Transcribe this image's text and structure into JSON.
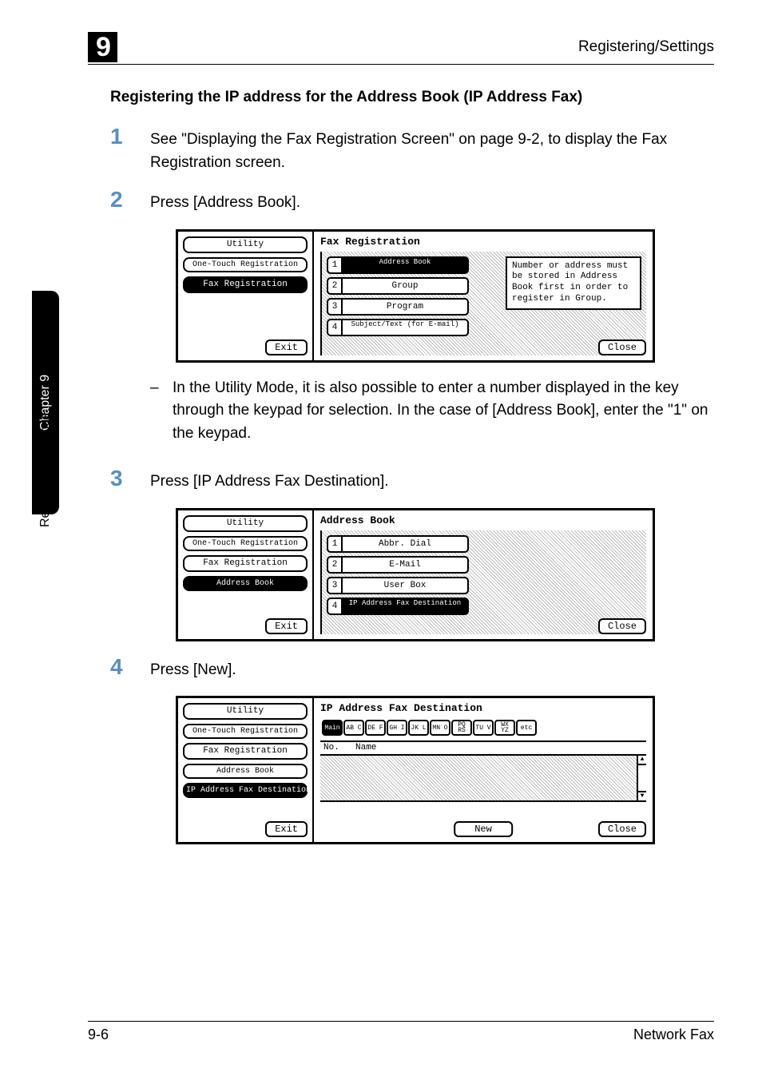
{
  "header": {
    "num": "9",
    "title": "Registering/Settings"
  },
  "side": {
    "chapter": "Chapter 9",
    "section": "Registering/Settings"
  },
  "title": "Registering the IP address for the Address Book (IP Address Fax)",
  "steps": {
    "1": {
      "num": "1",
      "text": "See \"Displaying the Fax Registration Screen\" on page 9-2, to display the Fax Registration screen."
    },
    "2": {
      "num": "2",
      "text": "Press [Address Book]."
    },
    "3": {
      "num": "3",
      "text": "Press [IP Address Fax Destination]."
    },
    "4": {
      "num": "4",
      "text": "Press [New]."
    }
  },
  "note2": "In the Utility Mode, it is also possible to enter a number displayed in the key through the keypad for selection. In the case of [Address Book], enter the \"1\" on the keypad.",
  "scr_common": {
    "exit": "Exit",
    "close": "Close"
  },
  "scr1": {
    "left": {
      "utility": "Utility",
      "onetouch": "One-Touch\nRegistration",
      "faxreg": "Fax Registration"
    },
    "title": "Fax Registration",
    "items": {
      "1": {
        "n": "1",
        "l": "Address\nBook"
      },
      "2": {
        "n": "2",
        "l": "Group"
      },
      "3": {
        "n": "3",
        "l": "Program"
      },
      "4": {
        "n": "4",
        "l": "Subject/Text\n(for E-mail)"
      }
    },
    "info": "Number or address must be stored in Address Book first in order to register in Group."
  },
  "scr2": {
    "left": {
      "utility": "Utility",
      "onetouch": "One-Touch\nRegistration",
      "faxreg": "Fax Registration",
      "addr": "Address\nBook"
    },
    "title": "Address Book",
    "items": {
      "1": {
        "n": "1",
        "l": "Abbr. Dial"
      },
      "2": {
        "n": "2",
        "l": "E-Mail"
      },
      "3": {
        "n": "3",
        "l": "User Box"
      },
      "4": {
        "n": "4",
        "l": "IP Address\nFax Destination"
      }
    }
  },
  "scr3": {
    "left": {
      "utility": "Utility",
      "onetouch": "One-Touch\nRegistration",
      "faxreg": "Fax Registration",
      "addr": "Address\nBook",
      "ipdest": "IP Address\nFax Destination"
    },
    "title": "IP Address Fax Destination",
    "tabs": [
      "Main",
      "AB\nC",
      "DE\nF",
      "GH\nI",
      "JK\nL",
      "MN\nO",
      "PQ\nRS",
      "TU\nV",
      "WX\nYZ",
      "etc"
    ],
    "cols": {
      "no": "No.",
      "name": "Name"
    },
    "newbtn": "New"
  },
  "footer": {
    "page": "9-6",
    "doc": "Network Fax"
  },
  "chart_data": null
}
